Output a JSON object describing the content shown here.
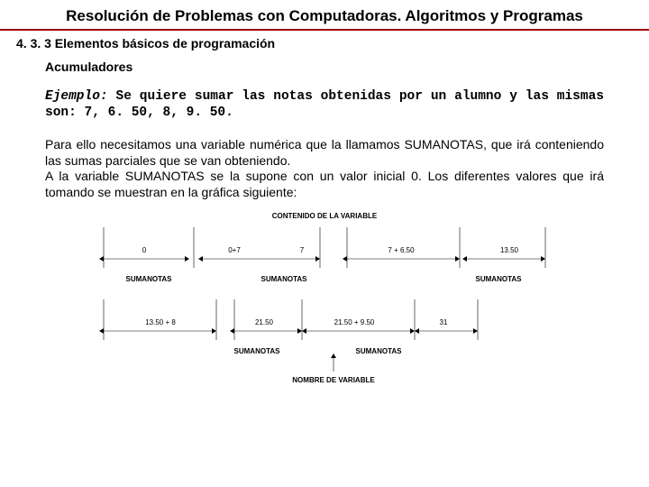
{
  "title": "Resolución de Problemas con Computadoras. Algoritmos y Programas",
  "section": "4. 3. 3 Elementos básicos de programación",
  "heading": "Acumuladores",
  "example_label": "Ejemplo:",
  "example_text": " Se quiere sumar las notas obtenidas por un alumno y las mismas son: 7, 6. 50, 8, 9. 50.",
  "paragraph": "Para ello necesitamos una variable numérica que la llamamos SUMANOTAS, que irá conteniendo las sumas parciales que se van obteniendo.\nA la variable SUMANOTAS se la supone con un valor inicial 0. Los diferentes valores que irá tomando se muestran en la gráfica siguiente:",
  "diagram": {
    "header": "CONTENIDO DE LA VARIABLE",
    "row1": [
      {
        "left": "0",
        "mid": "0+7",
        "right": "7"
      },
      {
        "left": "",
        "mid": "7 + 6.50",
        "right": "13.50"
      }
    ],
    "row1_names": [
      "SUMANOTAS",
      "SUMANOTAS",
      "SUMANOTAS"
    ],
    "row2": [
      {
        "left": "",
        "mid": "13.50 + 8",
        "right": ""
      },
      {
        "left": "21.50",
        "mid": "21.50 + 9.50",
        "right": "31"
      }
    ],
    "row2_names": [
      "SUMANOTAS",
      "SUMANOTAS"
    ],
    "footer": "NOMBRE DE VARIABLE"
  }
}
